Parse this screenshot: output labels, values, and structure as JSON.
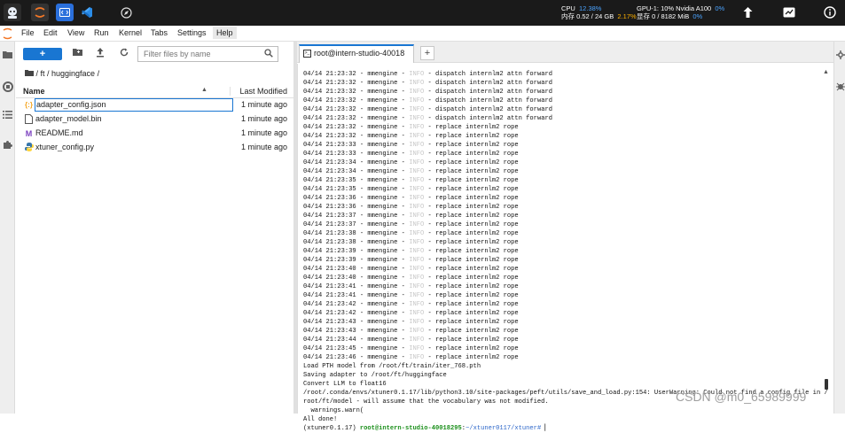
{
  "topbar": {
    "cpu_label": "CPU",
    "cpu_value": "12.38%",
    "mem_label": "内存",
    "mem_value": "0.52 / 24 GB",
    "mem_pct": "2.17%",
    "gpu_label": "GPU-1: 10% Nvidia A100",
    "gpu_value": "0%",
    "vram_label": "显存",
    "vram_value": "0 / 8182 MiB",
    "vram_pct": "0%"
  },
  "menubar": {
    "items": [
      "File",
      "Edit",
      "View",
      "Run",
      "Kernel",
      "Tabs",
      "Settings",
      "Help"
    ]
  },
  "filebrowser": {
    "new_label": "+",
    "filter_placeholder": "Filter files by name",
    "breadcrumb": "/ ft / huggingface /",
    "col_name": "Name",
    "col_modified": "Last Modified",
    "files": [
      {
        "name": "adapter_config.json",
        "modified": "1 minute ago",
        "icon": "{:}"
      },
      {
        "name": "adapter_model.bin",
        "modified": "1 minute ago",
        "icon": "▢"
      },
      {
        "name": "README.md",
        "modified": "1 minute ago",
        "icon": "M"
      },
      {
        "name": "xtuner_config.py",
        "modified": "1 minute ago",
        "icon": "py"
      }
    ]
  },
  "tabs": {
    "terminal_label": "root@intern-studio-40018",
    "add_label": "+"
  },
  "terminal": {
    "log_lines": [
      {
        "ts": "04/14 21:23:32",
        "msg": "dispatch internlm2 attn forward"
      },
      {
        "ts": "04/14 21:23:32",
        "msg": "dispatch internlm2 attn forward"
      },
      {
        "ts": "04/14 21:23:32",
        "msg": "dispatch internlm2 attn forward"
      },
      {
        "ts": "04/14 21:23:32",
        "msg": "dispatch internlm2 attn forward"
      },
      {
        "ts": "04/14 21:23:32",
        "msg": "dispatch internlm2 attn forward"
      },
      {
        "ts": "04/14 21:23:32",
        "msg": "dispatch internlm2 attn forward"
      },
      {
        "ts": "04/14 21:23:32",
        "msg": "replace internlm2 rope"
      },
      {
        "ts": "04/14 21:23:32",
        "msg": "replace internlm2 rope"
      },
      {
        "ts": "04/14 21:23:33",
        "msg": "replace internlm2 rope"
      },
      {
        "ts": "04/14 21:23:33",
        "msg": "replace internlm2 rope"
      },
      {
        "ts": "04/14 21:23:34",
        "msg": "replace internlm2 rope"
      },
      {
        "ts": "04/14 21:23:34",
        "msg": "replace internlm2 rope"
      },
      {
        "ts": "04/14 21:23:35",
        "msg": "replace internlm2 rope"
      },
      {
        "ts": "04/14 21:23:35",
        "msg": "replace internlm2 rope"
      },
      {
        "ts": "04/14 21:23:36",
        "msg": "replace internlm2 rope"
      },
      {
        "ts": "04/14 21:23:36",
        "msg": "replace internlm2 rope"
      },
      {
        "ts": "04/14 21:23:37",
        "msg": "replace internlm2 rope"
      },
      {
        "ts": "04/14 21:23:37",
        "msg": "replace internlm2 rope"
      },
      {
        "ts": "04/14 21:23:38",
        "msg": "replace internlm2 rope"
      },
      {
        "ts": "04/14 21:23:38",
        "msg": "replace internlm2 rope"
      },
      {
        "ts": "04/14 21:23:39",
        "msg": "replace internlm2 rope"
      },
      {
        "ts": "04/14 21:23:39",
        "msg": "replace internlm2 rope"
      },
      {
        "ts": "04/14 21:23:40",
        "msg": "replace internlm2 rope"
      },
      {
        "ts": "04/14 21:23:40",
        "msg": "replace internlm2 rope"
      },
      {
        "ts": "04/14 21:23:41",
        "msg": "replace internlm2 rope"
      },
      {
        "ts": "04/14 21:23:41",
        "msg": "replace internlm2 rope"
      },
      {
        "ts": "04/14 21:23:42",
        "msg": "replace internlm2 rope"
      },
      {
        "ts": "04/14 21:23:42",
        "msg": "replace internlm2 rope"
      },
      {
        "ts": "04/14 21:23:43",
        "msg": "replace internlm2 rope"
      },
      {
        "ts": "04/14 21:23:43",
        "msg": "replace internlm2 rope"
      },
      {
        "ts": "04/14 21:23:44",
        "msg": "replace internlm2 rope"
      },
      {
        "ts": "04/14 21:23:45",
        "msg": "replace internlm2 rope"
      },
      {
        "ts": "04/14 21:23:46",
        "msg": "replace internlm2 rope"
      }
    ],
    "log_logger": "mmengine",
    "log_level": "INFO",
    "out_lines": [
      "Load PTH model from /root/ft/train/iter_768.pth",
      "Saving adapter to /root/ft/huggingface",
      "Convert LLM to float16",
      "/root/.conda/envs/xtuner0.1.17/lib/python3.10/site-packages/peft/utils/save_and_load.py:154: UserWarning: Could not find a config file in /",
      "root/ft/model - will assume that the vocabulary was not modified.",
      "  warnings.warn(",
      "All done!"
    ],
    "prompt_env": "(xtuner0.1.17)",
    "prompt_user": "root@intern-studio-40018295",
    "prompt_path": "~/xtuner0117/xtuner#"
  },
  "watermark": "CSDN @m0_65989999",
  "colors": {
    "accent": "#1976d2",
    "topbar_bg": "#1a1a1a",
    "prompt_green": "#1a8f1a",
    "prompt_blue": "#2c66c9"
  }
}
